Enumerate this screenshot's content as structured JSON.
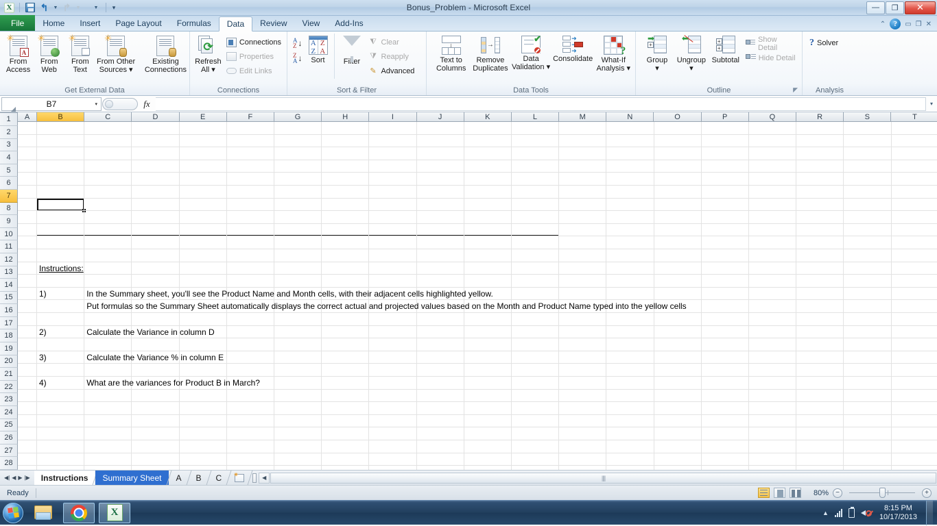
{
  "window": {
    "title": "Bonus_Problem  -  Microsoft Excel",
    "minimize": "—",
    "restore": "❐",
    "close": "✕",
    "collapse_ribbon": "⌃",
    "help": "?"
  },
  "qat": {
    "excel_logo": "X",
    "save": "save-icon",
    "undo": "↩",
    "redo": "↪",
    "customize": "▾"
  },
  "ribbon": {
    "tabs": [
      {
        "label": "File",
        "type": "file"
      },
      {
        "label": "Home",
        "type": "normal"
      },
      {
        "label": "Insert",
        "type": "normal"
      },
      {
        "label": "Page Layout",
        "type": "normal"
      },
      {
        "label": "Formulas",
        "type": "normal"
      },
      {
        "label": "Data",
        "type": "active"
      },
      {
        "label": "Review",
        "type": "normal"
      },
      {
        "label": "View",
        "type": "normal"
      },
      {
        "label": "Add-Ins",
        "type": "normal"
      }
    ],
    "groups": [
      {
        "name": "Get External Data",
        "buttons": [
          {
            "label_line1": "From",
            "label_line2": "Access"
          },
          {
            "label_line1": "From",
            "label_line2": "Web"
          },
          {
            "label_line1": "From",
            "label_line2": "Text"
          },
          {
            "label_line1": "From Other",
            "label_line2": "Sources ▾"
          },
          {
            "label_line1": "Existing",
            "label_line2": "Connections"
          }
        ]
      },
      {
        "name": "Connections",
        "refresh_line1": "Refresh",
        "refresh_line2": "All ▾",
        "items": [
          {
            "label": "Connections",
            "disabled": false
          },
          {
            "label": "Properties",
            "disabled": true
          },
          {
            "label": "Edit Links",
            "disabled": true
          }
        ]
      },
      {
        "name": "Sort & Filter",
        "sort_label": "Sort",
        "filter_label": "Filter",
        "items": [
          {
            "label": "Clear",
            "disabled": true
          },
          {
            "label": "Reapply",
            "disabled": true
          },
          {
            "label": "Advanced",
            "disabled": false
          }
        ]
      },
      {
        "name": "Data Tools",
        "buttons": [
          {
            "label_line1": "Text to",
            "label_line2": "Columns"
          },
          {
            "label_line1": "Remove",
            "label_line2": "Duplicates"
          },
          {
            "label_line1": "Data",
            "label_line2": "Validation ▾"
          },
          {
            "label_line1": "Consolidate",
            "label_line2": ""
          },
          {
            "label_line1": "What-If",
            "label_line2": "Analysis ▾"
          }
        ]
      },
      {
        "name": "Outline",
        "buttons": [
          {
            "label_line1": "Group",
            "label_line2": "▾"
          },
          {
            "label_line1": "Ungroup",
            "label_line2": "▾"
          },
          {
            "label_line1": "Subtotal",
            "label_line2": ""
          }
        ],
        "items": [
          {
            "label": "Show Detail",
            "disabled": true
          },
          {
            "label": "Hide Detail",
            "disabled": true
          }
        ],
        "dialog_launcher": "◤"
      },
      {
        "name": "Analysis",
        "solver_label": "Solver"
      }
    ]
  },
  "formula_bar": {
    "name_box": "B7",
    "fx_label": "fx",
    "formula_value": "",
    "dropdown": "▾",
    "expand": "▾"
  },
  "grid": {
    "columns": [
      "A",
      "B",
      "C",
      "D",
      "E",
      "F",
      "G",
      "H",
      "I",
      "J",
      "K",
      "L",
      "M",
      "N",
      "O",
      "P",
      "Q",
      "R",
      "S",
      "T"
    ],
    "selected_column": "B",
    "selected_row": 7,
    "first_row": 1,
    "last_row": 28,
    "active_cell": "B7",
    "content": {
      "heading": "Instructions:",
      "items": [
        {
          "num": "1)",
          "lines": [
            "In the Summary sheet, you'll see the Product Name and Month cells, with their adjacent cells highlighted yellow.",
            "Put formulas so the Summary Sheet automatically displays the correct actual and projected values based on the Month and Product Name typed into the yellow cells"
          ]
        },
        {
          "num": "2)",
          "lines": [
            "Calculate the Variance in column D"
          ]
        },
        {
          "num": "3)",
          "lines": [
            "Calculate the Variance % in column E"
          ]
        },
        {
          "num": "4)",
          "lines": [
            "What are the variances for Product B in March?"
          ]
        }
      ]
    }
  },
  "sheet_tabs": {
    "nav": {
      "first": "◀|",
      "prev": "◀",
      "next": "▶",
      "last": "|▶"
    },
    "tabs": [
      {
        "label": "Instructions",
        "state": "active"
      },
      {
        "label": "Summary Sheet",
        "state": "selected"
      },
      {
        "label": "A",
        "state": "normal"
      },
      {
        "label": "B",
        "state": "normal"
      },
      {
        "label": "C",
        "state": "normal"
      }
    ],
    "new_sheet": "insert-worksheet"
  },
  "status_bar": {
    "mode": "Ready",
    "zoom_level": "80%",
    "zoom_out": "−",
    "zoom_in": "+",
    "views": [
      "normal-view",
      "page-layout-view",
      "page-break-preview"
    ]
  },
  "taskbar": {
    "start": "start-orb",
    "apps": [
      "windows-explorer",
      "google-chrome",
      "microsoft-excel"
    ],
    "clock_time": "8:15 PM",
    "clock_date": "10/17/2013",
    "tray": [
      "show-hidden-icons",
      "network-signal",
      "battery",
      "volume-muted"
    ]
  }
}
